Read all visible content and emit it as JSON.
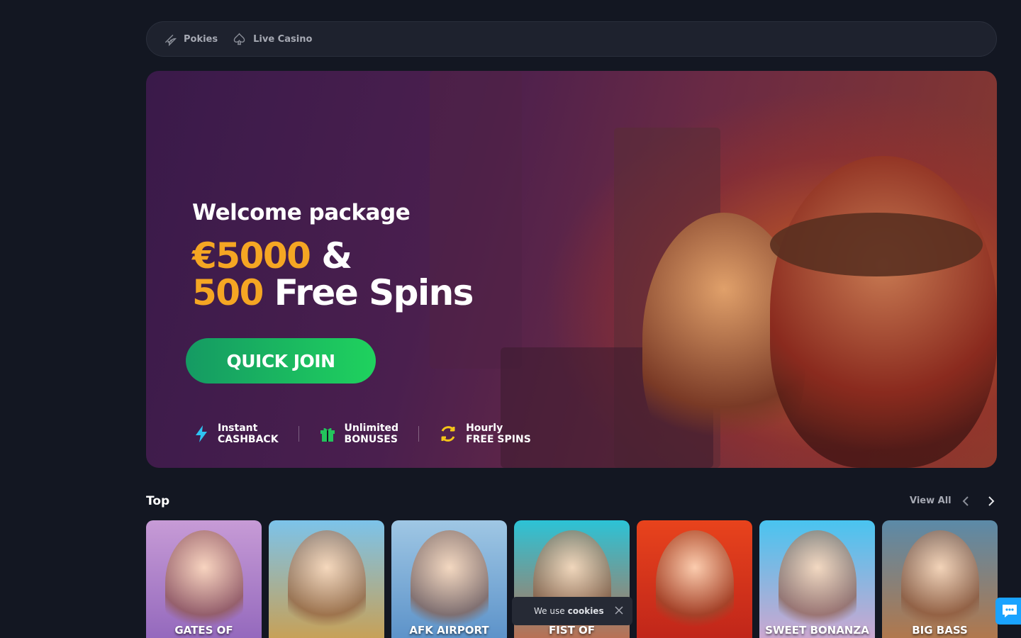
{
  "nav": {
    "items": [
      {
        "label": "Pokies",
        "icon": "watermelon-icon"
      },
      {
        "label": "Live Casino",
        "icon": "spade-icon"
      }
    ]
  },
  "hero": {
    "title": "Welcome package",
    "amount_gold": "€5000",
    "amount_rest": "&",
    "spins_gold": "500",
    "spins_rest": "Free Spins",
    "cta": "QUICK JOIN",
    "features": [
      {
        "top": "Instant",
        "bottom": "CASHBACK",
        "icon": "lightning-icon"
      },
      {
        "top": "Unlimited",
        "bottom": "BONUSES",
        "icon": "gift-icon"
      },
      {
        "top": "Hourly",
        "bottom": "FREE SPINS",
        "icon": "refresh-icon"
      }
    ]
  },
  "top_section": {
    "title": "Top",
    "view_all": "View All",
    "games": [
      {
        "name": "GATES OF",
        "colors": [
          "#c79bd6",
          "#8a5fb8"
        ]
      },
      {
        "name": "",
        "colors": [
          "#7cc3ea",
          "#d69a3a"
        ]
      },
      {
        "name": "AFK AIRPORT",
        "colors": [
          "#9fc7e4",
          "#4f88c4"
        ]
      },
      {
        "name": "FIST OF",
        "colors": [
          "#2cc3d6",
          "#d4603a"
        ]
      },
      {
        "name": "",
        "colors": [
          "#e8431c",
          "#b8201a"
        ]
      },
      {
        "name": "SWEET BONANZA",
        "colors": [
          "#49c4f0",
          "#e6a1c9"
        ]
      },
      {
        "name": "BIG BASS",
        "colors": [
          "#5b8aa8",
          "#c2743a"
        ]
      }
    ]
  },
  "cookie": {
    "prefix": "We use",
    "bold": "cookies"
  },
  "colors": {
    "accent_gold": "#f5a623",
    "cta_green": "#1fd25e",
    "chat_blue": "#1aa3ff"
  }
}
